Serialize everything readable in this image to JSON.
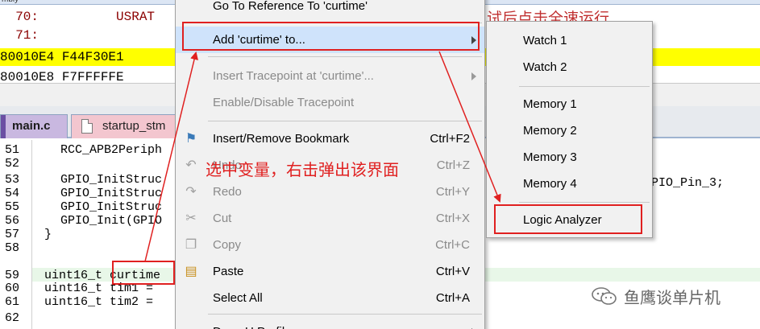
{
  "disassembly": {
    "pane_title": "mbly",
    "lines": [
      "  70:          USRAT",
      "  71:",
      "80010E4 F44F30E1",
      "80010E8 F7FFFFFE"
    ]
  },
  "tabs": [
    {
      "label": "main.c"
    },
    {
      "label": "startup_stm"
    }
  ],
  "editor": {
    "line_numbers": [
      "51",
      "52",
      "53",
      "54",
      "55",
      "56",
      "57",
      "58",
      "59",
      "60",
      "61",
      "62"
    ],
    "lines": [
      "RCC_APB2Periph",
      "",
      "GPIO_InitStruc",
      "GPIO_InitStruc",
      "GPIO_InitStruc",
      "GPIO_Init(GPIO",
      "}",
      "",
      "uint16_t curtime",
      "uint16_t tim1 =",
      "uint16_t tim2 =",
      ""
    ],
    "right_overflow": "PIO_Pin_3;"
  },
  "context_menu": {
    "items": [
      {
        "label": "Go To Reference To 'curtime'",
        "shortcut": "",
        "enabled": true,
        "submenu": false
      },
      {
        "label": "Add 'curtime' to...",
        "shortcut": "",
        "enabled": true,
        "submenu": true,
        "highlighted": true
      },
      {
        "label": "Insert Tracepoint at 'curtime'...",
        "shortcut": "",
        "enabled": false,
        "submenu": true
      },
      {
        "label": "Enable/Disable Tracepoint",
        "shortcut": "",
        "enabled": false,
        "submenu": false
      },
      {
        "label": "Insert/Remove Bookmark",
        "shortcut": "Ctrl+F2",
        "enabled": true,
        "submenu": false,
        "icon": "bookmark-icon"
      },
      {
        "label": "Undo",
        "shortcut": "Ctrl+Z",
        "enabled": false,
        "submenu": false,
        "icon": "undo-icon"
      },
      {
        "label": "Redo",
        "shortcut": "Ctrl+Y",
        "enabled": false,
        "submenu": false,
        "icon": "redo-icon"
      },
      {
        "label": "Cut",
        "shortcut": "Ctrl+X",
        "enabled": false,
        "submenu": false,
        "icon": "scissors-icon"
      },
      {
        "label": "Copy",
        "shortcut": "Ctrl+C",
        "enabled": false,
        "submenu": false,
        "icon": "copy-icon"
      },
      {
        "label": "Paste",
        "shortcut": "Ctrl+V",
        "enabled": true,
        "submenu": false,
        "icon": "paste-icon"
      },
      {
        "label": "Select All",
        "shortcut": "Ctrl+A",
        "enabled": true,
        "submenu": false
      },
      {
        "label": "Done U Profile",
        "shortcut": "",
        "enabled": true,
        "submenu": true
      }
    ]
  },
  "submenu": {
    "items": [
      "Watch 1",
      "Watch 2",
      "Memory 1",
      "Memory 2",
      "Memory 3",
      "Memory 4",
      "Logic Analyzer"
    ]
  },
  "annotations": {
    "instruction": "选中变量，右击弹出该界面",
    "top_text": "试后点击全速运行",
    "accent_color": "#e02020"
  },
  "watermark": {
    "text": "鱼鹰谈单片机",
    "icon": "wechat-icon"
  }
}
